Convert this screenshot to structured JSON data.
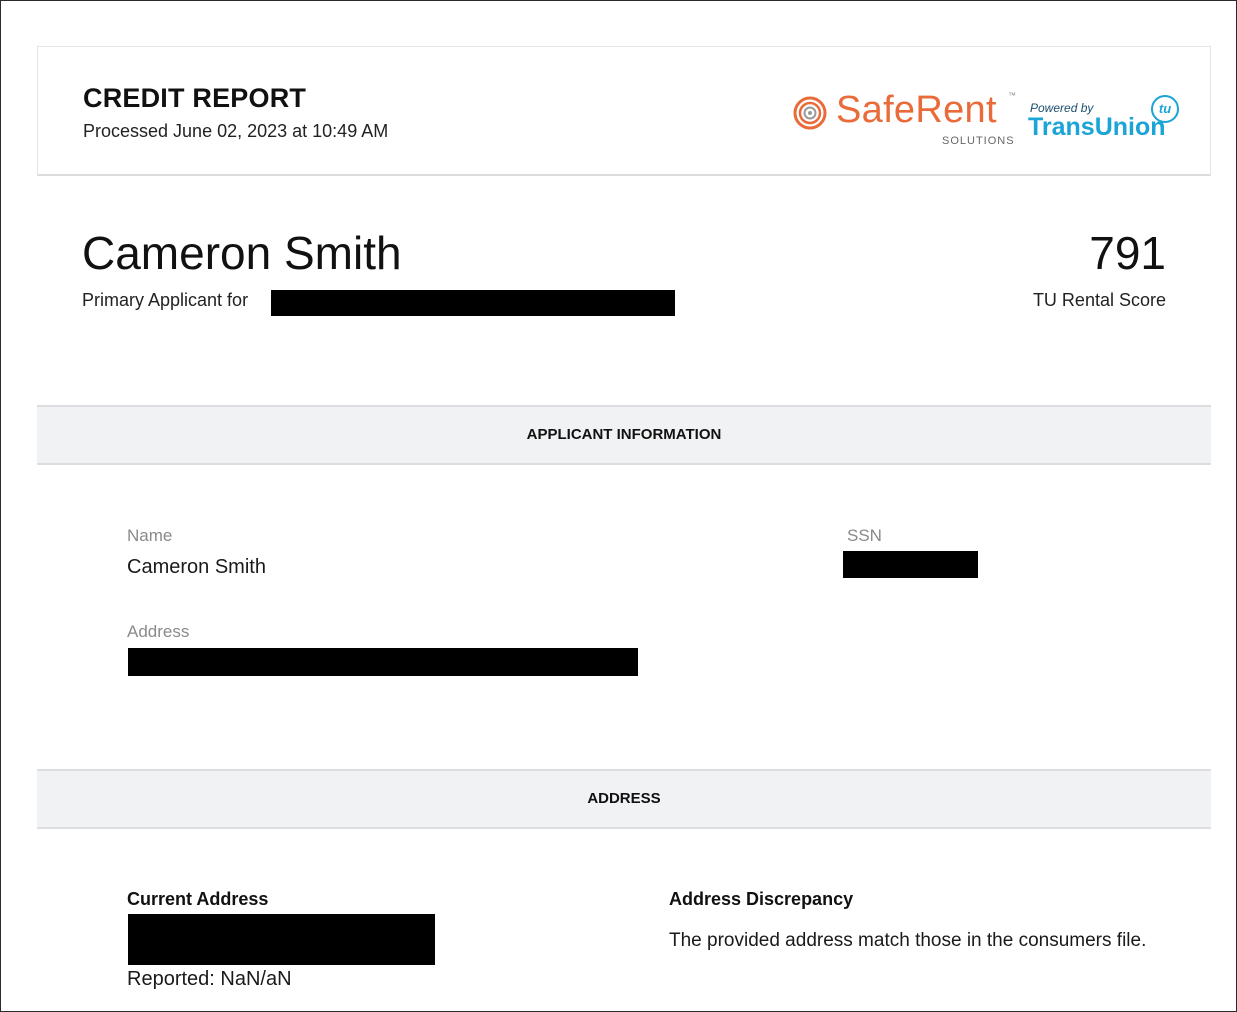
{
  "header": {
    "title": "CREDIT REPORT",
    "processed": "Processed June 02, 2023 at 10:49 AM",
    "logos": {
      "saferent": "SafeRent",
      "saferent_tm": "™",
      "saferent_sub": "SOLUTIONS",
      "powered_by": "Powered by",
      "transunion": "TransUnion",
      "tu_badge": "tu",
      "saferent_color": "#ea6b3a",
      "transunion_color": "#1ba4d6"
    }
  },
  "applicant": {
    "name": "Cameron Smith",
    "primary_for_label": "Primary Applicant for",
    "score": "791",
    "score_label": "TU Rental Score"
  },
  "sections": {
    "applicant_information": {
      "title": "APPLICANT INFORMATION",
      "name_label": "Name",
      "name_value": "Cameron Smith",
      "ssn_label": "SSN",
      "address_label": "Address"
    },
    "address": {
      "title": "ADDRESS",
      "current_address_label": "Current Address",
      "reported": "Reported: NaN/aN",
      "discrepancy_label": "Address Discrepancy",
      "discrepancy_text": "The provided address match those in the consumers file."
    }
  }
}
